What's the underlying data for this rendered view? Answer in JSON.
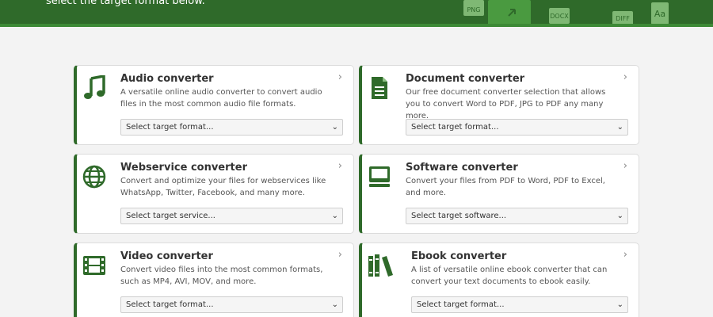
{
  "header": {
    "subtitle": "select the target format below.",
    "icons": [
      "PNG",
      "DOCX",
      "DIFF",
      "Aa"
    ]
  },
  "colors": {
    "brand": "#2f6a2a",
    "brand_light": "#3d8a36",
    "background": "#f3f3f3"
  },
  "cards": [
    {
      "icon": "music-note-icon",
      "title": "Audio converter",
      "description": "A versatile online audio converter to convert audio files in the most common audio file formats.",
      "select_value": "Select target format..."
    },
    {
      "icon": "document-icon",
      "title": "Document converter",
      "description": "Our free document converter selection that allows you to convert Word to PDF, JPG to PDF any many more.",
      "select_value": "Select target format..."
    },
    {
      "icon": "globe-icon",
      "title": "Webservice converter",
      "description": "Convert and optimize your files for webservices like WhatsApp, Twitter, Facebook, and many more.",
      "select_value": "Select target service..."
    },
    {
      "icon": "monitor-icon",
      "title": "Software converter",
      "description": "Convert your files from PDF to Word, PDF to Excel, and more.",
      "select_value": "Select target software..."
    },
    {
      "icon": "film-icon",
      "title": "Video converter",
      "description": "Convert video files into the most common formats, such as MP4, AVI, MOV, and more.",
      "select_value": "Select target format..."
    },
    {
      "icon": "books-icon",
      "title": "Ebook converter",
      "description": "A list of versatile online ebook converter that can convert your text documents to ebook easily.",
      "select_value": "Select target format..."
    }
  ]
}
